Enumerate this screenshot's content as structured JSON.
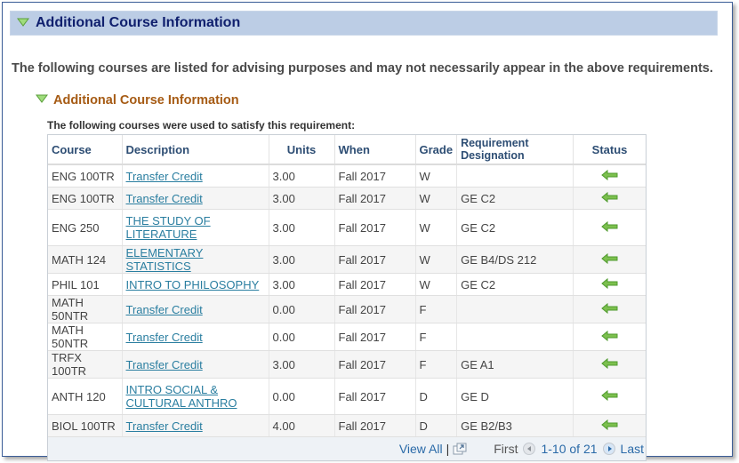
{
  "section": {
    "title": "Additional Course Information",
    "expand_icon": "triangle-down-icon"
  },
  "intro_text": "The following courses are listed for advising purposes and may not necessarily appear in the above requirements.",
  "subsection": {
    "title": "Additional Course Information",
    "caption": "The following courses were used to satisfy this requirement:"
  },
  "table": {
    "columns": [
      "Course",
      "Description",
      "Units",
      "When",
      "Grade",
      "Requirement Designation",
      "Status"
    ],
    "rows": [
      {
        "course": "ENG 100TR",
        "description": "Transfer Credit",
        "units": "3.00",
        "when": "Fall 2017",
        "grade": "W",
        "designation": "",
        "status": "taken-arrow-icon"
      },
      {
        "course": "ENG 100TR",
        "description": "Transfer Credit",
        "units": "3.00",
        "when": "Fall 2017",
        "grade": "W",
        "designation": "GE C2",
        "status": "taken-arrow-icon"
      },
      {
        "course": "ENG 250",
        "description": "THE STUDY OF LITERATURE",
        "units": "3.00",
        "when": "Fall 2017",
        "grade": "W",
        "designation": "GE C2",
        "status": "taken-arrow-icon"
      },
      {
        "course": "MATH 124",
        "description": "ELEMENTARY STATISTICS",
        "units": "3.00",
        "when": "Fall 2017",
        "grade": "W",
        "designation": "GE B4/DS 212",
        "status": "taken-arrow-icon"
      },
      {
        "course": "PHIL 101",
        "description": "INTRO TO PHILOSOPHY",
        "units": "3.00",
        "when": "Fall 2017",
        "grade": "W",
        "designation": "GE C2",
        "status": "taken-arrow-icon"
      },
      {
        "course": "MATH 50NTR",
        "description": "Transfer Credit",
        "units": "0.00",
        "when": "Fall 2017",
        "grade": "F",
        "designation": "",
        "status": "taken-arrow-icon"
      },
      {
        "course": "MATH 50NTR",
        "description": "Transfer Credit",
        "units": "0.00",
        "when": "Fall 2017",
        "grade": "F",
        "designation": "",
        "status": "taken-arrow-icon"
      },
      {
        "course": "TRFX 100TR",
        "description": "Transfer Credit",
        "units": "3.00",
        "when": "Fall 2017",
        "grade": "F",
        "designation": "GE A1",
        "status": "taken-arrow-icon"
      },
      {
        "course": "ANTH 120",
        "description": "INTRO SOCIAL & CULTURAL ANTHRO",
        "units": "0.00",
        "when": "Fall 2017",
        "grade": "D",
        "designation": "GE D",
        "status": "taken-arrow-icon"
      },
      {
        "course": "BIOL 100TR",
        "description": "Transfer Credit",
        "units": "4.00",
        "when": "Fall 2017",
        "grade": "D",
        "designation": "GE B2/B3",
        "status": "taken-arrow-icon"
      }
    ]
  },
  "pagination": {
    "view_all": "View All",
    "separator": "|",
    "first": "First",
    "range": "1-10 of 21",
    "last": "Last"
  },
  "colors": {
    "section_bar": "#bccde5",
    "section_title": "#10206e",
    "subsection_title": "#a65b14",
    "link": "#2a7ea0",
    "status_arrow": "#5aa832"
  }
}
